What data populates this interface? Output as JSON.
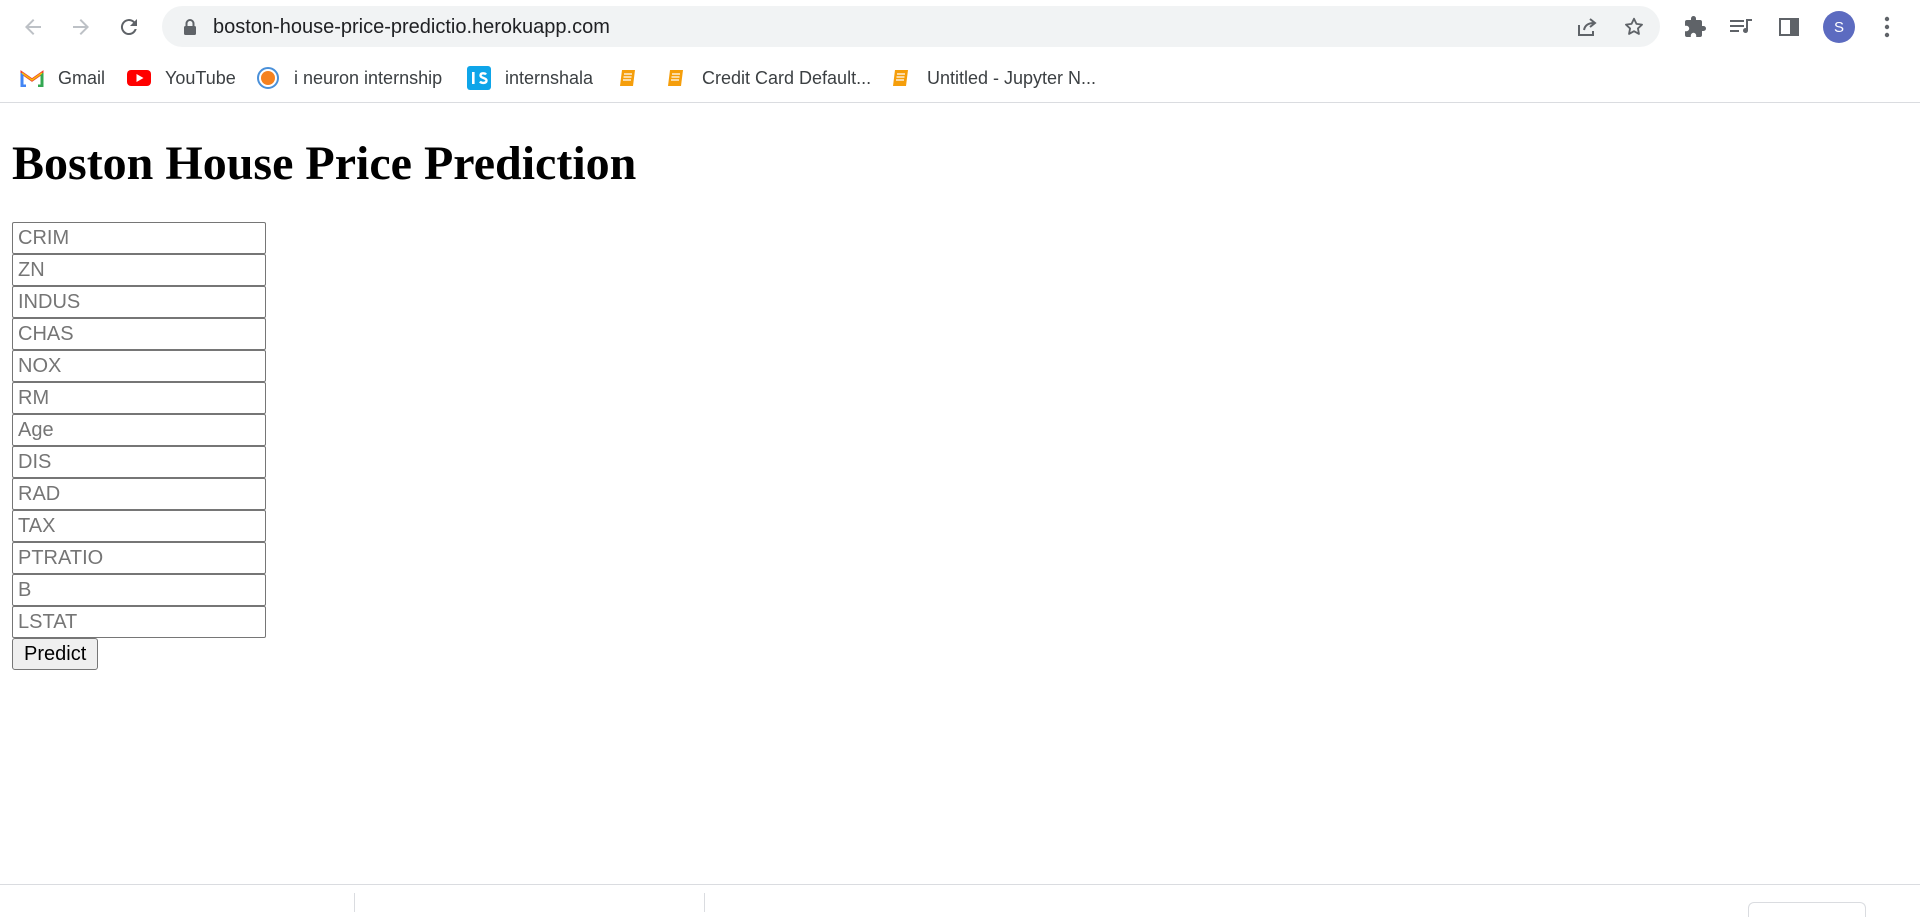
{
  "browser": {
    "url": "boston-house-price-predictio.herokuapp.com",
    "profile_initial": "S",
    "bookmarks": [
      {
        "label": "Gmail",
        "icon": "gmail-icon"
      },
      {
        "label": "YouTube",
        "icon": "youtube-icon"
      },
      {
        "label": "i neuron internship",
        "icon": "ineuron-icon"
      },
      {
        "label": "internshala",
        "icon": "internshala-icon"
      },
      {
        "label": "",
        "icon": "notebook-icon"
      },
      {
        "label": "Credit Card Default...",
        "icon": "notebook-icon"
      },
      {
        "label": "Untitled - Jupyter N...",
        "icon": "notebook-icon"
      }
    ]
  },
  "page": {
    "title": "Boston House Price Prediction",
    "fields": {
      "crim": "CRIM",
      "zn": "ZN",
      "indus": "INDUS",
      "chas": "CHAS",
      "nox": "NOX",
      "rm": "RM",
      "age": "Age",
      "dis": "DIS",
      "rad": "RAD",
      "tax": "TAX",
      "ptratio": "PTRATIO",
      "b": "B",
      "lstat": "LSTAT"
    },
    "submit_label": "Predict"
  },
  "colors": {
    "avatar": "#5c6bc0",
    "youtube_red": "#ff0000",
    "internshala_blue": "#0ea5e9",
    "notebook_orange": "#f59e0b"
  }
}
